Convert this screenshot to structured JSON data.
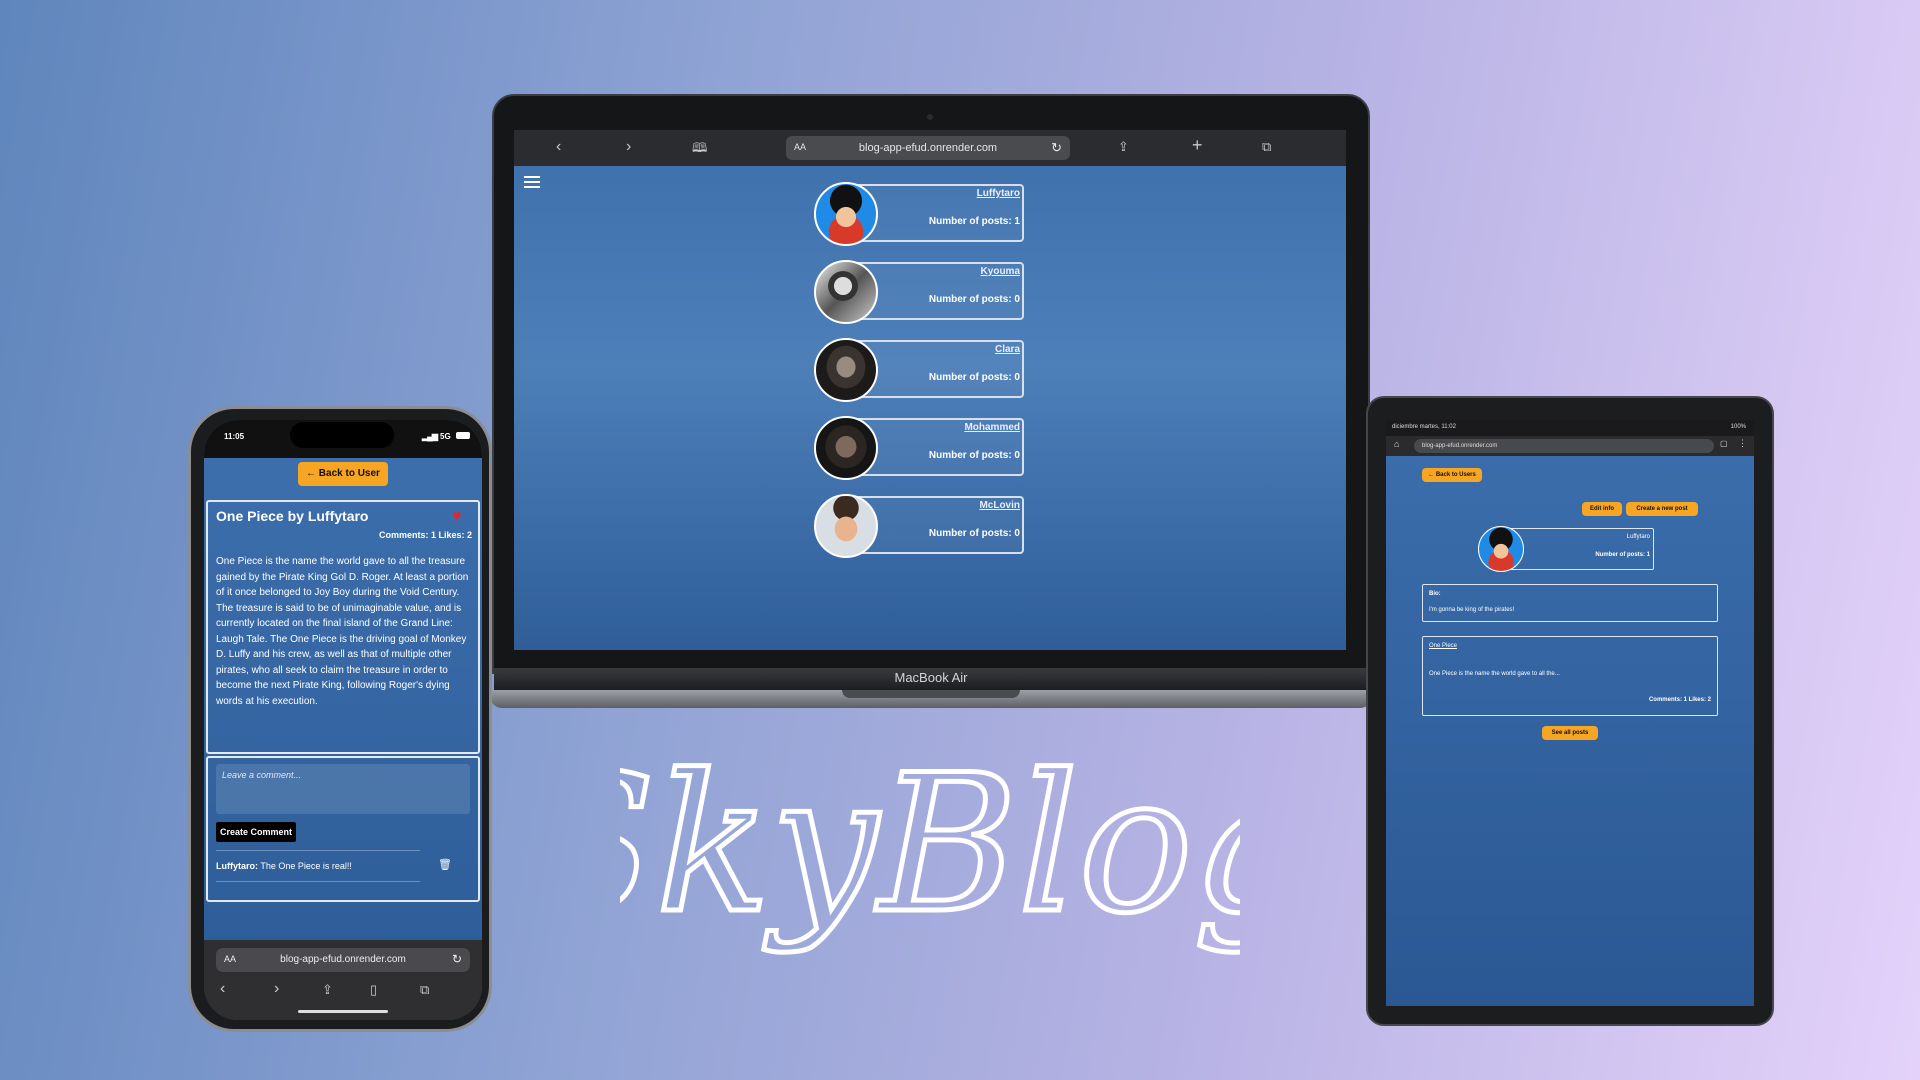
{
  "laptop": {
    "url": "blog-app-efud.onrender.com",
    "aa": "AA",
    "device_label": "MacBook Air",
    "users": [
      {
        "name": "Luffytaro",
        "posts": "Number of posts: 1"
      },
      {
        "name": "Kyouma",
        "posts": "Number of posts: 0"
      },
      {
        "name": "Clara",
        "posts": "Number of posts: 0"
      },
      {
        "name": "Mohammed",
        "posts": "Number of posts: 0"
      },
      {
        "name": "McLovin",
        "posts": "Number of posts: 0"
      }
    ]
  },
  "phone": {
    "time": "11:05",
    "signal": "5G",
    "back_button": "← Back to User",
    "post_title": "One Piece by Luffytaro",
    "post_stats": "Comments: 1 Likes: 2",
    "post_body": "One Piece is the name the world gave to all the treasure gained by the Pirate King Gol D. Roger. At least a portion of it once belonged to Joy Boy during the Void Century. The treasure is said to be of unimaginable value, and is currently located on the final island of the Grand Line: Laugh Tale. The One Piece is the driving goal of Monkey D. Luffy and his crew, as well as that of multiple other pirates, who all seek to claim the treasure in order to become the next Pirate King, following Roger's dying words at his execution.",
    "comment_placeholder": "Leave a comment...",
    "create_comment": "Create Comment",
    "comment_author": "Luffytaro:",
    "comment_text": " The One Piece is real!!",
    "url": "blog-app-efud.onrender.com",
    "aa": "AA"
  },
  "tablet": {
    "status_left": "diciembre martes, 11:02",
    "status_right": "100%",
    "url": "blog-app-efud.onrender.com",
    "back_button": "← Back to Users",
    "edit_button": "Edit info",
    "create_button": "Create a new post",
    "user_name": "Luffytaro",
    "user_posts": "Number of posts: 1",
    "bio_label": "Bio:",
    "bio_text": "I'm gonna be king of the pirates!",
    "post_title": "One Piece",
    "post_excerpt": "One Piece is the name the world gave to all the...",
    "post_stats": "Comments: 1 Likes: 2",
    "see_all": "See all posts"
  },
  "logo_text": "SkyBlog",
  "colors": {
    "accent": "#f6a623",
    "screen_blue": "#3d6fab",
    "background_start": "#5f86bd",
    "background_end": "#e4d2fa"
  }
}
